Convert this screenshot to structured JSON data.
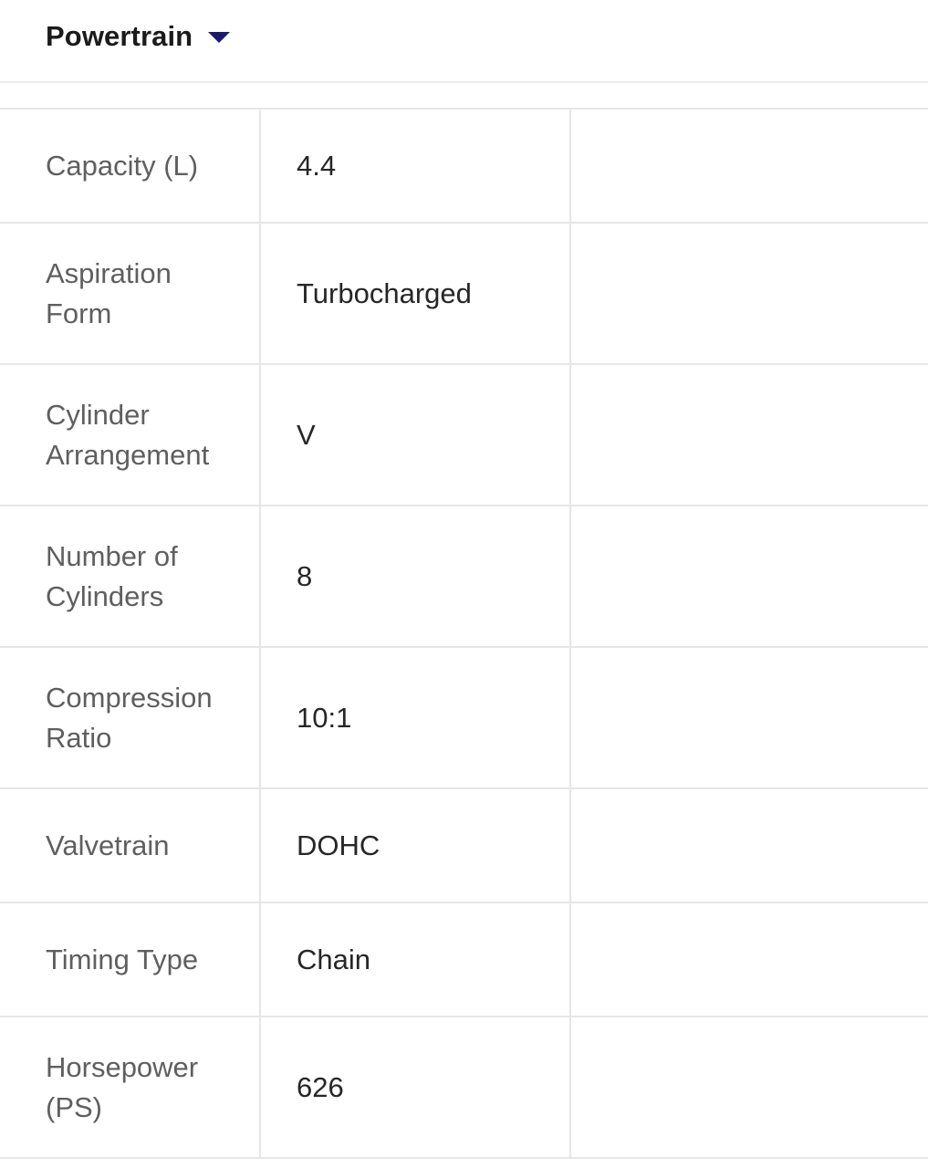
{
  "section": {
    "title": "Powertrain",
    "toggle_icon": "caret-down-icon",
    "accent_color": "#1a1a6e"
  },
  "specs": [
    {
      "label": "Capacity (L)",
      "value": "4.4"
    },
    {
      "label": "Aspiration Form",
      "value": "Turbocharged"
    },
    {
      "label": "Cylinder Arrangement",
      "value": "V"
    },
    {
      "label": "Number of Cylinders",
      "value": "8"
    },
    {
      "label": "Compression Ratio",
      "value": "10:1"
    },
    {
      "label": "Valvetrain",
      "value": "DOHC"
    },
    {
      "label": "Timing Type",
      "value": "Chain"
    },
    {
      "label": "Horsepower (PS)",
      "value": "626"
    }
  ]
}
